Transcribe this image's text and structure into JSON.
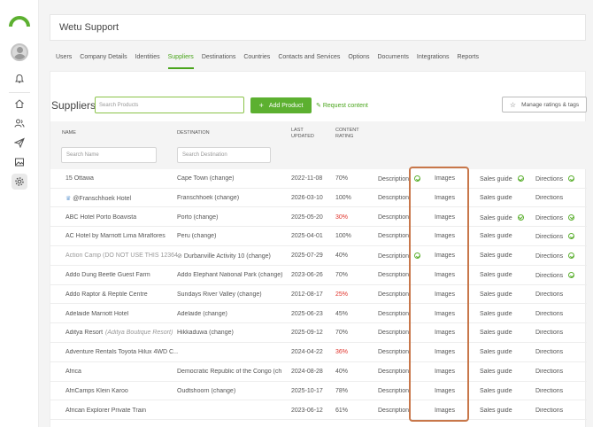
{
  "app": {
    "title": "Wetu Support"
  },
  "rail": {
    "icons": [
      "bell-icon",
      "home-icon",
      "users-icon",
      "send-icon",
      "image-icon",
      "settings-icon"
    ]
  },
  "tabs": [
    "Users",
    "Company Details",
    "Identities",
    "Suppliers",
    "Destinations",
    "Countries",
    "Contacts and Services",
    "Options",
    "Documents",
    "Integrations",
    "Reports"
  ],
  "active_tab": "Suppliers",
  "toolbar": {
    "title": "Suppliers",
    "search_placeholder": "Search Products",
    "add_label": "Add Product",
    "request_label": "Request content",
    "manage_label": "Manage ratings & tags"
  },
  "columns": {
    "name": "NAME",
    "destination": "DESTINATION",
    "updated": "LAST UPDATED",
    "rating": "CONTENT RATING"
  },
  "filters": {
    "name_placeholder": "Search Name",
    "dest_placeholder": "Search Destination"
  },
  "rows": [
    {
      "name": "15 Ottawa",
      "dest": "Cape Town (change)",
      "date": "2022-11-08",
      "rating": "70%",
      "rating_color": "normal",
      "desc_check": true,
      "images": "Images",
      "sales_check": true,
      "dir_check": true
    },
    {
      "name": "@Franschhoek Hotel",
      "dest": "Franschhoek (change)",
      "date": "2026-03-10",
      "rating": "100%",
      "rating_color": "normal",
      "desc_check": false,
      "images": "Images",
      "sales_check": false,
      "dir_check": false,
      "crown": true
    },
    {
      "name": "ABC Hotel Porto Boavista",
      "dest": "Porto (change)",
      "date": "2025-05-20",
      "rating": "30%",
      "rating_color": "red",
      "desc_check": false,
      "images": "Images",
      "sales_check": true,
      "dir_check": true
    },
    {
      "name": "AC Hotel by Marriott Lima Miraflores",
      "dest": "Peru (change)",
      "date": "2025-04-01",
      "rating": "100%",
      "rating_color": "normal",
      "desc_check": false,
      "images": "Images",
      "sales_check": false,
      "dir_check": true
    },
    {
      "name": "Action Camp (DO NOT USE THIS 12364)",
      "dest": "Durbanville Activity 10 (change)",
      "date": "2025-07-29",
      "rating": "40%",
      "rating_color": "normal",
      "desc_check": true,
      "images": "Images",
      "sales_check": false,
      "dir_check": true,
      "muted_name": true,
      "eye_off": true
    },
    {
      "name": "Addo Dung Beetle Guest Farm",
      "dest": "Addo Elephant National Park (change)",
      "date": "2023-06-26",
      "rating": "70%",
      "rating_color": "normal",
      "desc_check": false,
      "images": "Images",
      "sales_check": false,
      "dir_check": true
    },
    {
      "name": "Addo Raptor & Reptile Centre",
      "dest": "Sundays River Valley (change)",
      "date": "2012-08-17",
      "rating": "25%",
      "rating_color": "red",
      "desc_check": false,
      "images": "Images",
      "sales_check": false,
      "dir_check": false
    },
    {
      "name": "Adelaide Marriott Hotel",
      "dest": "Adelaide (change)",
      "date": "2025-06-23",
      "rating": "45%",
      "rating_color": "normal",
      "desc_check": false,
      "images": "Images",
      "sales_check": false,
      "dir_check": false
    },
    {
      "name": "Aditya Resort",
      "name_extra": "(Aditya Boutique Resort)",
      "dest": "Hikkaduwa (change)",
      "date": "2025-09-12",
      "rating": "70%",
      "rating_color": "normal",
      "desc_check": false,
      "images": "Images",
      "sales_check": false,
      "dir_check": false
    },
    {
      "name": "Adventure Rentals Toyota Hilux 4WD C...",
      "dest": "",
      "date": "2024-04-22",
      "rating": "36%",
      "rating_color": "red",
      "desc_check": false,
      "images": "Images",
      "sales_check": false,
      "dir_check": false
    },
    {
      "name": "Africa",
      "dest": "Democratic Republic of the Congo (ch",
      "date": "2024-08-28",
      "rating": "40%",
      "rating_color": "normal",
      "desc_check": false,
      "images": "Images",
      "sales_check": false,
      "dir_check": false
    },
    {
      "name": "AfriCamps Klein Karoo",
      "dest": "Oudtshoorn (change)",
      "date": "2025-10-17",
      "rating": "78%",
      "rating_color": "normal",
      "desc_check": false,
      "images": "Images",
      "sales_check": false,
      "dir_check": false
    },
    {
      "name": "African Explorer Private Train",
      "dest": "",
      "date": "2023-06-12",
      "rating": "61%",
      "rating_color": "normal",
      "desc_check": false,
      "images": "Images",
      "sales_check": false,
      "dir_check": false
    }
  ],
  "labels": {
    "description": "Description",
    "sales": "Sales guide",
    "directions": "Directions"
  },
  "colors": {
    "accent": "#5cb030",
    "red": "#e0322a",
    "highlight": "#c8774a"
  }
}
